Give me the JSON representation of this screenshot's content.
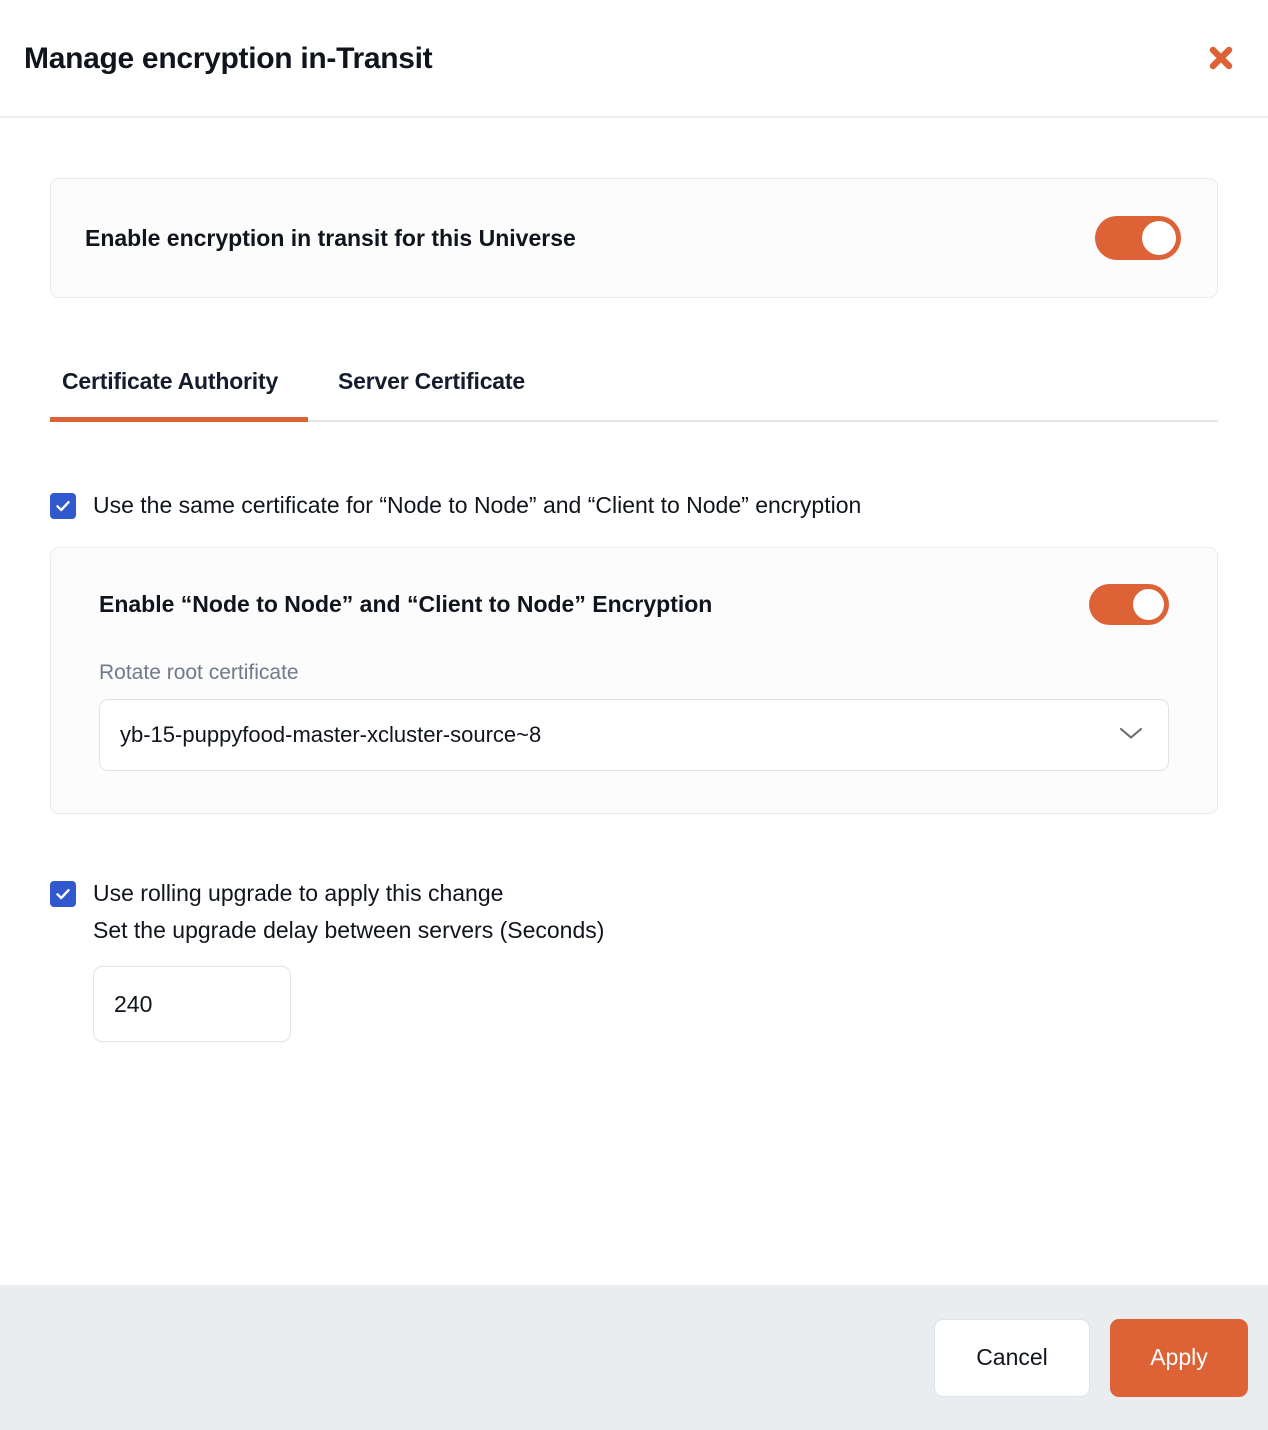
{
  "header": {
    "title": "Manage encryption in-Transit",
    "close_icon": "close-icon"
  },
  "enable_card": {
    "label": "Enable encryption in transit for this Universe",
    "toggle_state": "on"
  },
  "tabs": [
    {
      "label": "Certificate Authority",
      "active": true
    },
    {
      "label": "Server Certificate",
      "active": false
    }
  ],
  "same_certificate": {
    "label": "Use the same certificate for “Node to Node” and “Client to Node” encryption",
    "checked": true
  },
  "cert_card": {
    "title": "Enable “Node to Node” and “Client to Node” Encryption",
    "toggle_state": "on",
    "field_label": "Rotate root certificate",
    "selected_value": "yb-15-puppyfood-master-xcluster-source~8",
    "chevron_icon": "chevron-down-icon"
  },
  "rolling_upgrade": {
    "label": "Use rolling upgrade to apply this change",
    "checked": true,
    "delay_label": "Set the upgrade delay between servers (Seconds)",
    "delay_value": "240"
  },
  "footer": {
    "cancel_label": "Cancel",
    "apply_label": "Apply"
  },
  "colors": {
    "accent": "#dd6236",
    "checkbox": "#3158ce",
    "footer_bg": "#eaedf0",
    "card_bg": "#fcfcfd",
    "muted_text": "#6f7a8b"
  }
}
